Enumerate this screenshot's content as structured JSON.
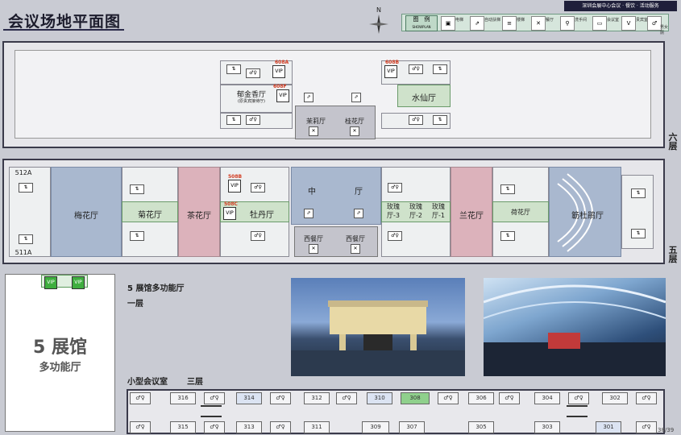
{
  "title": "会议场地平面图",
  "compass": "N",
  "brand": "深圳会展中心会议 · 餐饮 · 活动服务",
  "legend": {
    "title": "图　例",
    "title_en": "SHOWPLAN",
    "items": [
      "电梯",
      "自动扶梯",
      "楼梯",
      "餐厅",
      "洗手间",
      "会议室",
      "贵宾室",
      "男女厕"
    ]
  },
  "page_number": "38/39",
  "floor6": {
    "label": "六层",
    "rooms": {
      "yujinxiang": "郁金香厅",
      "yujinxiang_sub": "(原贵宾接待厅)",
      "shuixian": "水仙厅",
      "molihua": "茉莉厅",
      "guihua": "桂花厅"
    },
    "codes": [
      "608A",
      "608F",
      "608B"
    ]
  },
  "floor5": {
    "label": "五层",
    "codes": [
      "512A",
      "511A",
      "508B",
      "508C"
    ],
    "rooms": {
      "meihua": "梅花厅",
      "juhua": "菊花厅",
      "chahua": "茶花厅",
      "mudan": "牡丹厅",
      "zhong": "中",
      "ting": "厅",
      "xican1": "西餐厅",
      "xican2": "西餐厅",
      "meigui3": "玫瑰厅-3",
      "meigui2": "玫瑰厅-2",
      "meigui1": "玫瑰厅-1",
      "lanhua": "兰花厅",
      "hehua": "荷花厅",
      "dujuan": "簕杜鹃厅"
    }
  },
  "hall5": {
    "name": "5 展馆",
    "sub": "多功能厅",
    "section": "5 展馆多功能厅",
    "floor": "一层"
  },
  "small_rooms": {
    "heading": "小型会议室",
    "floor": "三层",
    "top": [
      "316",
      "314",
      "312",
      "310",
      "308",
      "306",
      "304",
      "302"
    ],
    "bottom": [
      "315",
      "313",
      "311",
      "309",
      "307",
      "305",
      "303",
      "301"
    ]
  }
}
